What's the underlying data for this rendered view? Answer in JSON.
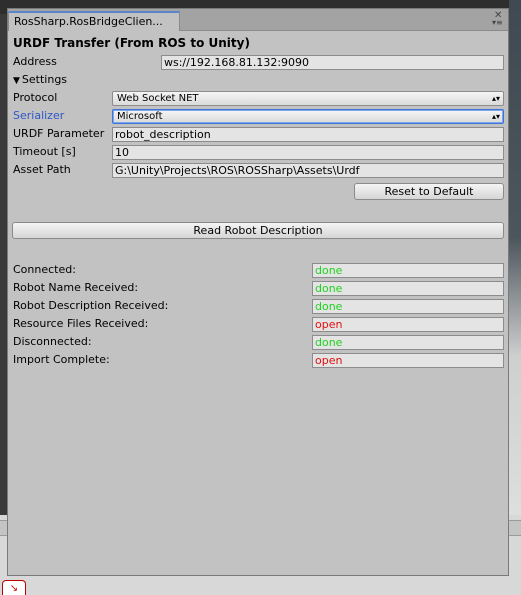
{
  "window": {
    "tab_title": "RosSharp.RosBridgeClien...",
    "heading": "URDF Transfer (From ROS to Unity)"
  },
  "fields": {
    "address_label": "Address",
    "address_value": "ws://192.168.81.132:9090",
    "settings_label": "Settings",
    "protocol_label": "Protocol",
    "protocol_value": "Web Socket NET",
    "serializer_label": "Serializer",
    "serializer_value": "Microsoft",
    "urdf_param_label": "URDF Parameter",
    "urdf_param_value": "robot_description",
    "timeout_label": "Timeout [s]",
    "timeout_value": "10",
    "asset_path_label": "Asset Path",
    "asset_path_value": "G:\\Unity\\Projects\\ROS\\ROSSharp\\Assets\\Urdf"
  },
  "buttons": {
    "reset": "Reset to Default",
    "read": "Read Robot Description"
  },
  "status": [
    {
      "label": "Connected:",
      "value": "done"
    },
    {
      "label": "Robot Name Received:",
      "value": "done"
    },
    {
      "label": "Robot Description Received:",
      "value": "done"
    },
    {
      "label": "Resource Files Received:",
      "value": "open"
    },
    {
      "label": "Disconnected:",
      "value": "done"
    },
    {
      "label": "Import Complete:",
      "value": "open"
    }
  ],
  "colors": {
    "done": "#1fd21f",
    "open": "#e01010",
    "accent": "#2d57c8"
  }
}
